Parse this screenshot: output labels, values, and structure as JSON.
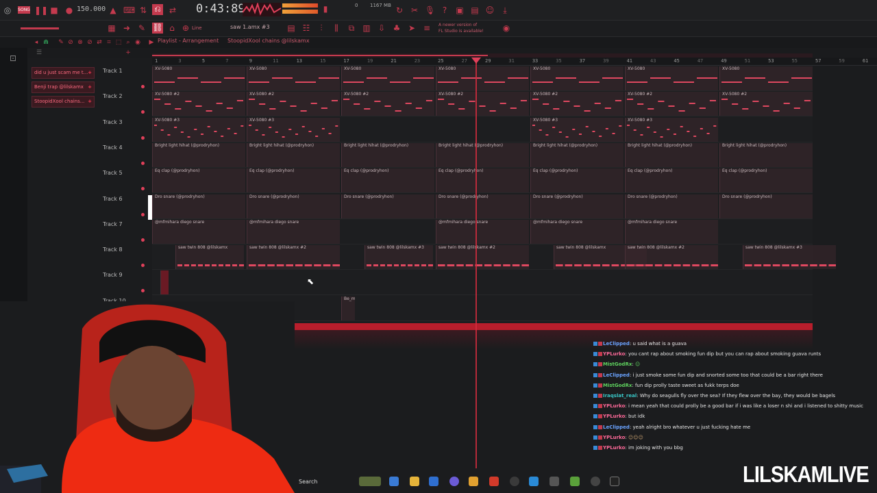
{
  "toolbar": {
    "song_tag": "SONG",
    "tempo": "150.000",
    "time": "0:43:89",
    "memory": "1167 MB",
    "memory_value": "0",
    "pattern": "saw 1.amx #3",
    "line_mode": "Line",
    "update_notice_line1": "A newer version of",
    "update_notice_line2": "FL Studio is available!"
  },
  "playlist": {
    "title": "Playlist - Arrangement",
    "breadcrumb": "StoopidXool chains @lilskamx",
    "ruler_numbers": [
      "1",
      "5",
      "9",
      "13",
      "17",
      "21",
      "25",
      "29",
      "33",
      "37",
      "41",
      "45",
      "49",
      "53",
      "57",
      "61"
    ],
    "ruler_minor": [
      "3",
      "7",
      "11",
      "15",
      "19",
      "23",
      "27",
      "31",
      "35",
      "39",
      "43",
      "47",
      "51",
      "55",
      "59"
    ],
    "playhead_bar": "29"
  },
  "patterns": [
    {
      "label": "did u just scam me t..."
    },
    {
      "label": "Benji trap @lilskamx"
    },
    {
      "label": "StoopidXool chains..."
    }
  ],
  "tracks": [
    {
      "name": "Track 1",
      "clip_label": "XV-5080",
      "clips": [
        {
          "label": "XV-5080"
        },
        {
          "label": "XV-5080"
        },
        {
          "label": "XV-5080"
        },
        {
          "label": "XV-5080"
        },
        {
          "label": "XV-5080"
        },
        {
          "label": "XV-5080"
        },
        {
          "label": "XV-5080"
        }
      ]
    },
    {
      "name": "Track 2",
      "clips": [
        {
          "label": "XV-5080 #2"
        },
        {
          "label": "XV-5080 #2"
        },
        {
          "label": "XV-5080 #2"
        },
        {
          "label": "XV-5080 #2"
        },
        {
          "label": "XV-5080 #2"
        },
        {
          "label": "XV-5080 #2"
        },
        {
          "label": "XV-5080 #2"
        }
      ]
    },
    {
      "name": "Track 3",
      "clips": [
        {
          "label": "XV-5080 #3"
        },
        {
          "label": "XV-5080 #3"
        },
        {
          "label": "XV-5080 #3"
        },
        {
          "label": "XV-5080 #3"
        }
      ]
    },
    {
      "name": "Track 4",
      "clips": [
        {
          "label": "Bright light hihat (@prodryhon)"
        },
        {
          "label": "Bright light hihat (@prodryhon)"
        },
        {
          "label": "Bright light hihat (@prodryhon)"
        },
        {
          "label": "Bright light hihat (@prodryhon)"
        },
        {
          "label": "Bright light hihat (@prodryhon)"
        },
        {
          "label": "Bright light hihat (@prodryhon)"
        },
        {
          "label": "Bright light hihat (@prodryhon)"
        }
      ]
    },
    {
      "name": "Track 5",
      "clips": [
        {
          "label": "Eq clap (@prodryhon)"
        },
        {
          "label": "Eq clap (@prodryhon)"
        },
        {
          "label": "Eq clap (@prodryhon)"
        },
        {
          "label": "Eq clap (@prodryhon)"
        },
        {
          "label": "Eq clap (@prodryhon)"
        },
        {
          "label": "Eq clap (@prodryhon)"
        },
        {
          "label": "Eq clap (@prodryhon)"
        }
      ]
    },
    {
      "name": "Track 6",
      "clips": [
        {
          "label": "Dro snare (@prodryhon)"
        },
        {
          "label": "Dro snare (@prodryhon)"
        },
        {
          "label": "Dro snare (@prodryhon)"
        },
        {
          "label": "Dro snare (@prodryhon)"
        },
        {
          "label": "Dro snare (@prodryhon)"
        },
        {
          "label": "Dro snare (@prodryhon)"
        },
        {
          "label": "Dro snare (@prodryhon)"
        }
      ]
    },
    {
      "name": "Track 7",
      "clips": [
        {
          "label": "@mfmihara diego snare"
        },
        {
          "label": "@mfmihara diego snare"
        },
        {
          "label": "@mfmihara diego snare"
        },
        {
          "label": "@mfmihara diego snare"
        },
        {
          "label": "@mfmihara diego snare"
        }
      ]
    },
    {
      "name": "Track 8",
      "clips": [
        {
          "label": "saw twin 808 @lilskamx"
        },
        {
          "label": "saw twin 808 @lilskamx #2"
        },
        {
          "label": "saw twin 808 @lilskamx #3"
        },
        {
          "label": "saw twin 808 @lilskamx #2"
        },
        {
          "label": "saw twin 808 @lilskamx"
        },
        {
          "label": "saw twin 808 @lilskamx #2"
        },
        {
          "label": "saw twin 808 @lilskamx #3"
        }
      ]
    },
    {
      "name": "Track 9",
      "clips": []
    },
    {
      "name": "Track 10",
      "clips": [
        {
          "label": "Be_mx"
        }
      ]
    }
  ],
  "chat": [
    {
      "user": "LeClipped",
      "user_color": "#6aa3ff",
      "text": ": u said what is a guava"
    },
    {
      "user": "YPLurko",
      "user_color": "#ff6a9a",
      "text": ": you cant rap about smoking fun dip but you can rap about smoking guava runts"
    },
    {
      "user": "MistGodRx",
      "user_color": "#5fd35f",
      "text": ": "
    },
    {
      "user": "LeClipped",
      "user_color": "#6aa3ff",
      "text": ": i just smoke some fun dip and snorted some too that could be a bar right there"
    },
    {
      "user": "MistGodRx",
      "user_color": "#5fd35f",
      "text": ": fun dip prolly taste sweet as fukk terps doe"
    },
    {
      "user": "Iraqslat_real",
      "user_color": "#39c6c6",
      "text": ": Why do seagulls fly over the sea? If they flew over the bay, they would be bagels"
    },
    {
      "user": "YPLurko",
      "user_color": "#ff6a9a",
      "text": ": i mean yeah that could prolly be a good bar if i was like a loser n shi and i listened to shitty music"
    },
    {
      "user": "YPLurko",
      "user_color": "#ff6a9a",
      "text": ": but idk"
    },
    {
      "user": "LeClipped",
      "user_color": "#6aa3ff",
      "text": ": yeah alright bro whatever u just fucking hate me"
    },
    {
      "user": "YPLurko",
      "user_color": "#ff6a9a",
      "text": ": "
    },
    {
      "user": "YPLurko",
      "user_color": "#ff6a9a",
      "text": ": im joking with you bbg"
    }
  ],
  "taskbar": {
    "search_label": "Search"
  },
  "overlay": {
    "brand": "LILSKAMLIVE"
  },
  "colors": {
    "accent": "#e0405a",
    "clip_note": "#e04860",
    "playhead": "#d22b3e",
    "bg": "#1b1c1e"
  }
}
